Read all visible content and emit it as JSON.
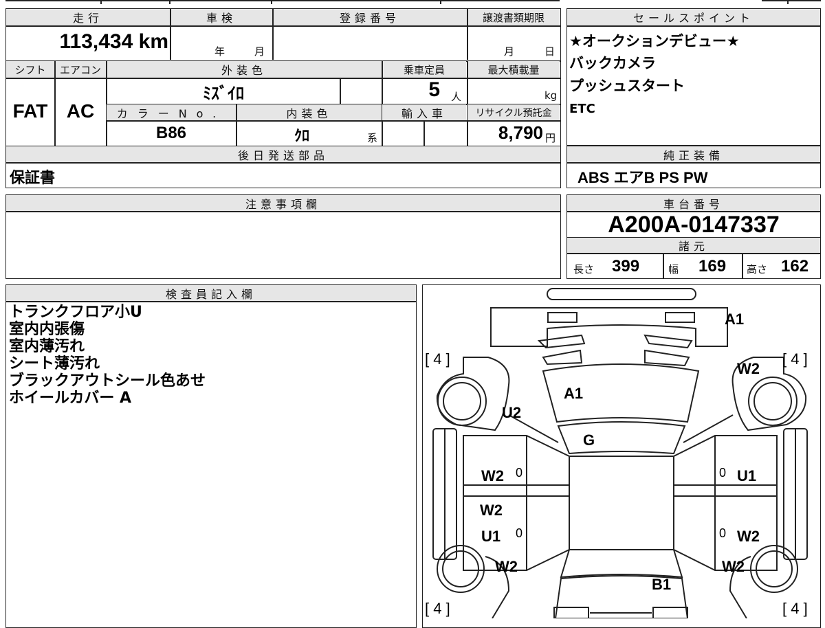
{
  "sheet": {
    "mileage_label": "走行",
    "mileage_value": "113,434 km",
    "inspection_label": "車検",
    "inspection_year": "年",
    "inspection_month": "月",
    "registration_label": "登録番号",
    "transfer_label": "譲渡書類期限",
    "transfer_month": "月",
    "transfer_day": "日",
    "shift_label": "シフト",
    "shift_value": "FAT",
    "ac_label": "エアコン",
    "ac_value": "AC",
    "exterior_label": "外装色",
    "exterior_value": "ﾐｽﾞｲﾛ",
    "capacity_label": "乗車定員",
    "capacity_value": "5",
    "capacity_unit": "人",
    "maxload_label": "最大積載量",
    "maxload_unit": "kg",
    "color_no_label": "カラーNo.",
    "color_no_value": "B86",
    "interior_label": "内装色",
    "interior_value": "ｸﾛ",
    "interior_unit": "系",
    "import_label": "輸入車",
    "recycle_label": "リサイクル預託金",
    "recycle_value": "8,790",
    "recycle_unit": "円",
    "later_parts_label": "後日発送部品",
    "later_parts_value": "保証書",
    "caution_label": "注意事項欄",
    "inspector_label": "検査員記入欄",
    "inspector_notes": [
      "トランクフロア小U",
      "室内内張傷",
      "室内薄汚れ",
      "シート薄汚れ",
      "ブラックアウトシール色あせ",
      "ホイールカバー A"
    ]
  },
  "sales_points": {
    "label": "セールスポイント",
    "items": [
      "★オークションデビュー★",
      "バックカメラ",
      "プッシュスタート",
      "ETC"
    ]
  },
  "equipment": {
    "label": "純正装備",
    "value": "ABS エアB PS PW"
  },
  "chassis": {
    "label": "車台番号",
    "value": "A200A-0147337"
  },
  "specs": {
    "label": "諸元",
    "length_label": "長さ",
    "length_value": "399",
    "width_label": "幅",
    "width_value": "169",
    "height_label": "高さ",
    "height_value": "162"
  },
  "diagram": {
    "tire_fl": "[ 4 ]",
    "tire_fr": "[ 4 ]",
    "tire_rl": "[ 4 ]",
    "tire_rr": "[ 4 ]",
    "marks": {
      "front_bumper": "A1",
      "front_right_fender": "W2",
      "hood": "A1",
      "front_left_fender": "U2",
      "windshield": "G",
      "left_front_door": "W2",
      "left_front_door_zero": "0",
      "right_front_door": "U1",
      "right_front_door_zero": "0",
      "left_rear_door_upper": "W2",
      "left_rear_door": "U1",
      "left_rear_door_zero": "0",
      "right_rear_door": "W2",
      "right_rear_door_zero": "0",
      "left_rear_fender": "W2",
      "right_rear_fender": "W2",
      "rear": "B1"
    }
  }
}
